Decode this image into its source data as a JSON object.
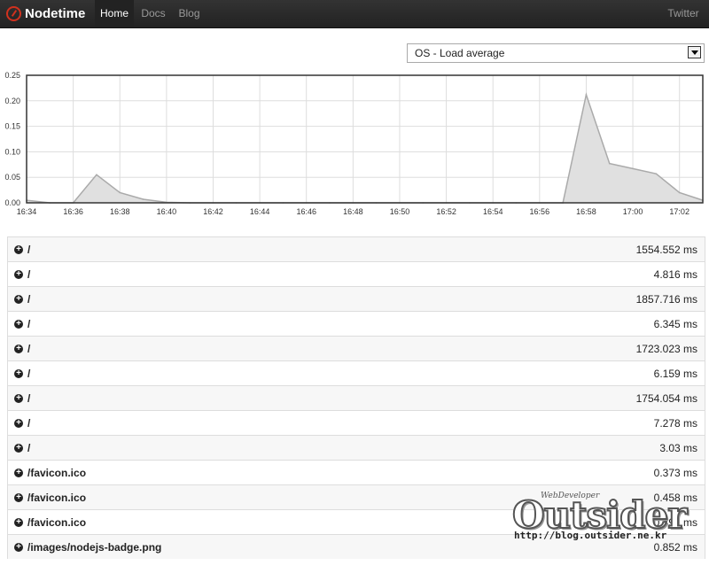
{
  "navbar": {
    "brand": "Nodetime",
    "items": [
      {
        "label": "Home",
        "active": true
      },
      {
        "label": "Docs",
        "active": false
      },
      {
        "label": "Blog",
        "active": false
      }
    ],
    "twitter": "Twitter"
  },
  "metric_select": {
    "value": "OS - Load average"
  },
  "chart_data": {
    "type": "area",
    "x": [
      "16:34",
      "16:35",
      "16:36",
      "16:37",
      "16:38",
      "16:39",
      "16:40",
      "16:41",
      "16:42",
      "16:43",
      "16:44",
      "16:45",
      "16:46",
      "16:47",
      "16:48",
      "16:49",
      "16:50",
      "16:51",
      "16:52",
      "16:53",
      "16:54",
      "16:55",
      "16:56",
      "16:57",
      "16:58",
      "16:59",
      "17:00",
      "17:01",
      "17:02",
      "17:03"
    ],
    "values": [
      0.005,
      0,
      0,
      0.055,
      0.02,
      0.007,
      0.001,
      0,
      0,
      0,
      0,
      0,
      0,
      0,
      0,
      0,
      0,
      0,
      0,
      0,
      0,
      0,
      0,
      0,
      0.212,
      0.077,
      0.067,
      0.057,
      0.02,
      0.005
    ],
    "x_tick_labels": [
      "16:34",
      "16:36",
      "16:38",
      "16:40",
      "16:42",
      "16:44",
      "16:46",
      "16:48",
      "16:50",
      "16:52",
      "16:54",
      "16:56",
      "16:58",
      "17:00",
      "17:02"
    ],
    "y_tick_labels": [
      "0.00",
      "0.05",
      "0.10",
      "0.15",
      "0.20",
      "0.25"
    ],
    "ylim": [
      0,
      0.25
    ],
    "grid": true,
    "colors": {
      "fill": "#e0e0e0",
      "line": "#aaaaaa",
      "grid": "#dddddd"
    }
  },
  "requests": [
    {
      "path": "/",
      "time": "1554.552 ms"
    },
    {
      "path": "/",
      "time": "4.816 ms"
    },
    {
      "path": "/",
      "time": "1857.716 ms"
    },
    {
      "path": "/",
      "time": "6.345 ms"
    },
    {
      "path": "/",
      "time": "1723.023 ms"
    },
    {
      "path": "/",
      "time": "6.159 ms"
    },
    {
      "path": "/",
      "time": "1754.054 ms"
    },
    {
      "path": "/",
      "time": "7.278 ms"
    },
    {
      "path": "/",
      "time": "3.03 ms"
    },
    {
      "path": "/favicon.ico",
      "time": "0.373 ms"
    },
    {
      "path": "/favicon.ico",
      "time": "0.458 ms"
    },
    {
      "path": "/favicon.ico",
      "time": "0.496 ms"
    },
    {
      "path": "/images/nodejs-badge.png",
      "time": "0.852 ms"
    }
  ],
  "watermark": {
    "top": "WebDeveloper",
    "name": "Outsider",
    "url": "http://blog.outsider.ne.kr"
  }
}
